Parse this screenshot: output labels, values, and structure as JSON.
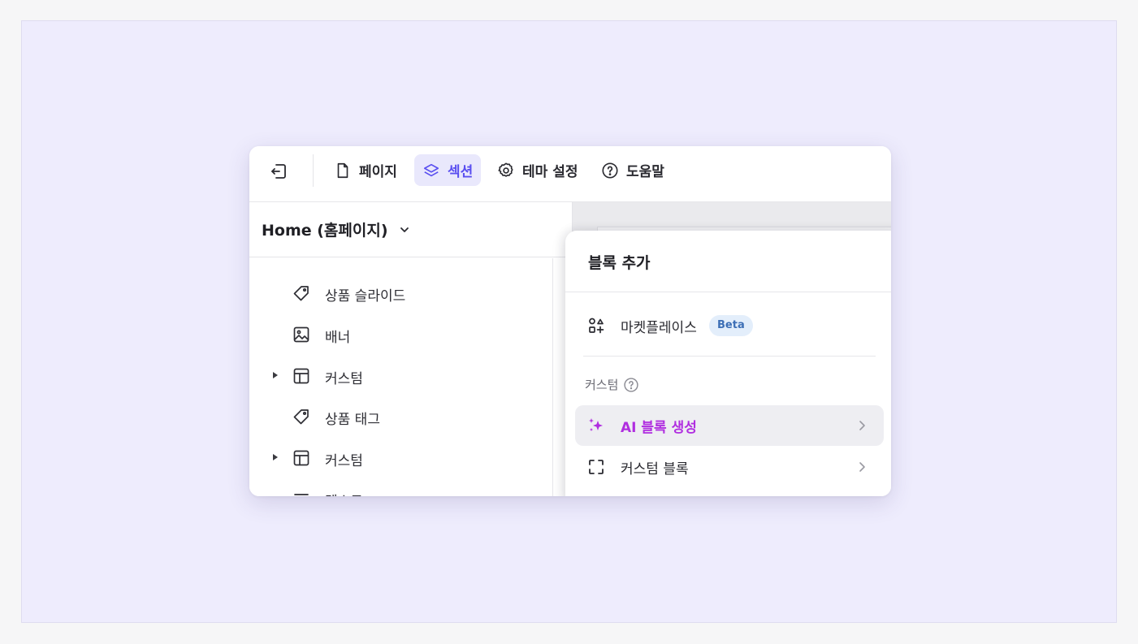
{
  "toolbar": {
    "page_label": "페이지",
    "section_label": "섹션",
    "theme_label": "테마 설정",
    "help_label": "도움말"
  },
  "left_panel": {
    "page_title": "Home (홈페이지)",
    "tree_items": [
      {
        "label": "상품 슬라이드",
        "icon": "tag-icon",
        "expandable": false
      },
      {
        "label": "배너",
        "icon": "image-icon",
        "expandable": false
      },
      {
        "label": "커스텀",
        "icon": "layout-icon",
        "expandable": true
      },
      {
        "label": "상품 태그",
        "icon": "tag-icon",
        "expandable": false
      },
      {
        "label": "커스텀",
        "icon": "layout-icon",
        "expandable": true
      },
      {
        "label": "텍스트",
        "icon": "text-icon",
        "expandable": false
      }
    ]
  },
  "popover": {
    "title": "블록 추가",
    "marketplace_label": "마켓플레이스",
    "marketplace_badge": "Beta",
    "custom_group_label": "커스텀",
    "ai_block_label": "AI 블록 생성",
    "custom_block_label": "커스텀 블록"
  },
  "colors": {
    "accent": "#5a4ff0",
    "accent_bg": "#e9e8fc",
    "ai": "#b02ee0",
    "badge_bg": "#e3eefb",
    "badge_text": "#3d6fb6",
    "stage_bg": "#eeecfd"
  }
}
